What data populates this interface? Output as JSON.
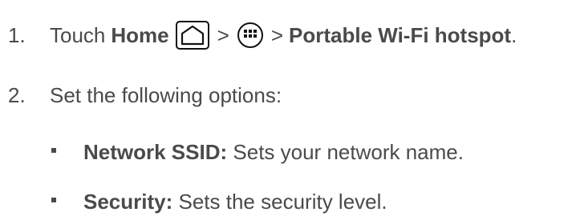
{
  "steps": [
    {
      "number": "1.",
      "text_before": "Touch",
      "home_label": "Home",
      "separator1": ">",
      "separator2": ">",
      "destination": "Portable Wi-Fi hotspot",
      "end_period": ".",
      "icons": [
        "home-icon",
        "apps-icon"
      ]
    },
    {
      "number": "2.",
      "text": "Set the following options:"
    }
  ],
  "options": [
    {
      "term": "Network SSID:",
      "description": "Sets your network name."
    },
    {
      "term": "Security:",
      "description": "Sets the security level."
    }
  ]
}
